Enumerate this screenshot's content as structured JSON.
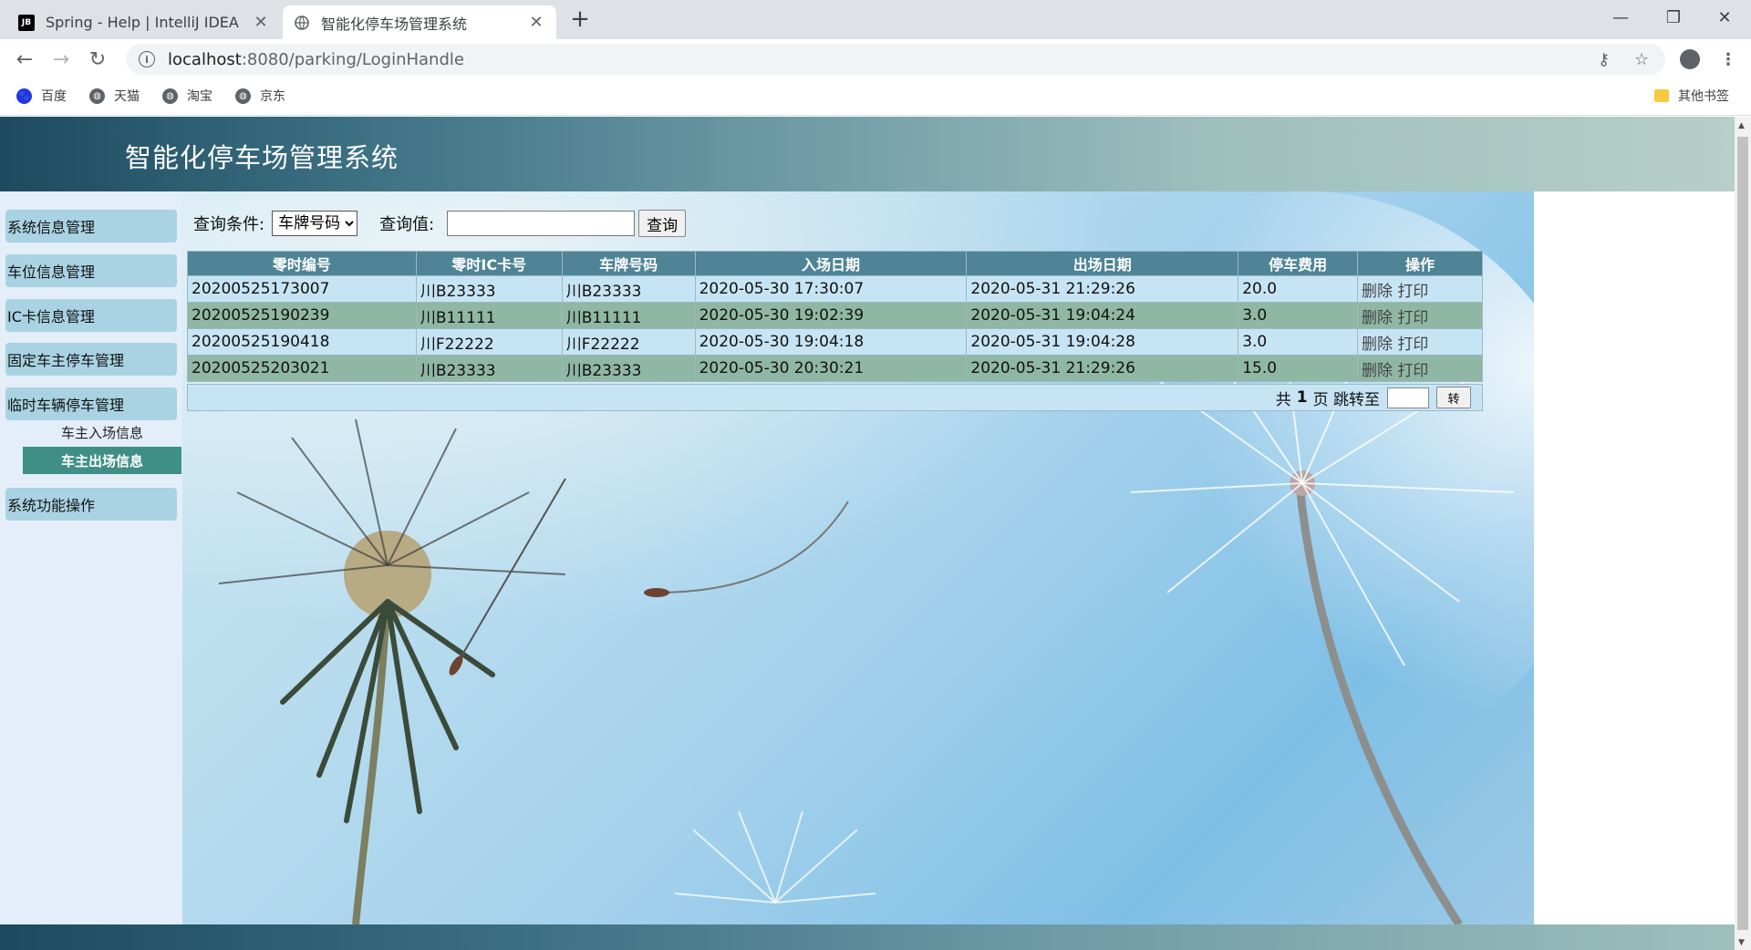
{
  "browser": {
    "tabs": [
      {
        "title": "Spring - Help | IntelliJ IDEA",
        "favicon": "JB"
      },
      {
        "title": "智能化停车场管理系统",
        "favicon": "globe"
      }
    ],
    "url_host": "localhost",
    "url_rest": ":8080/parking/LoginHandle",
    "bookmarks": [
      "百度",
      "天猫",
      "淘宝",
      "京东"
    ],
    "other_bookmarks": "其他书签"
  },
  "header": {
    "title": "智能化停车场管理系统"
  },
  "sidebar": {
    "items": [
      {
        "label": "系统信息管理"
      },
      {
        "label": "车位信息管理"
      },
      {
        "label": "IC卡信息管理"
      },
      {
        "label": "固定车主停车管理"
      },
      {
        "label": "临时车辆停车管理"
      }
    ],
    "subitems": [
      {
        "label": "车主入场信息"
      },
      {
        "label": "车主出场信息"
      }
    ],
    "last_item": {
      "label": "系统功能操作"
    }
  },
  "query": {
    "condition_label": "查询条件:",
    "condition_selected": "车牌号码",
    "value_label": "查询值:",
    "value_input": "",
    "search_button": "查询"
  },
  "table": {
    "headers": [
      "零时编号",
      "零时IC卡号",
      "车牌号码",
      "入场日期",
      "出场日期",
      "停车费用",
      "操作"
    ],
    "rows": [
      [
        "20200525173007",
        "川B23333",
        "川B23333",
        "2020-05-30 17:30:07",
        "2020-05-31 21:29:26",
        "20.0"
      ],
      [
        "20200525190239",
        "川B11111",
        "川B11111",
        "2020-05-30 19:02:39",
        "2020-05-31 19:04:24",
        "3.0"
      ],
      [
        "20200525190418",
        "川F22222",
        "川F22222",
        "2020-05-30 19:04:18",
        "2020-05-31 19:04:28",
        "3.0"
      ],
      [
        "20200525203021",
        "川B23333",
        "川B23333",
        "2020-05-30 20:30:21",
        "2020-05-31 21:29:26",
        "15.0"
      ]
    ],
    "op_delete": "删除",
    "op_print": "打印"
  },
  "pager": {
    "total_prefix": "共",
    "total_pages": "1",
    "total_suffix": "页 跳转至",
    "jump_input": "",
    "go_button": "转"
  }
}
